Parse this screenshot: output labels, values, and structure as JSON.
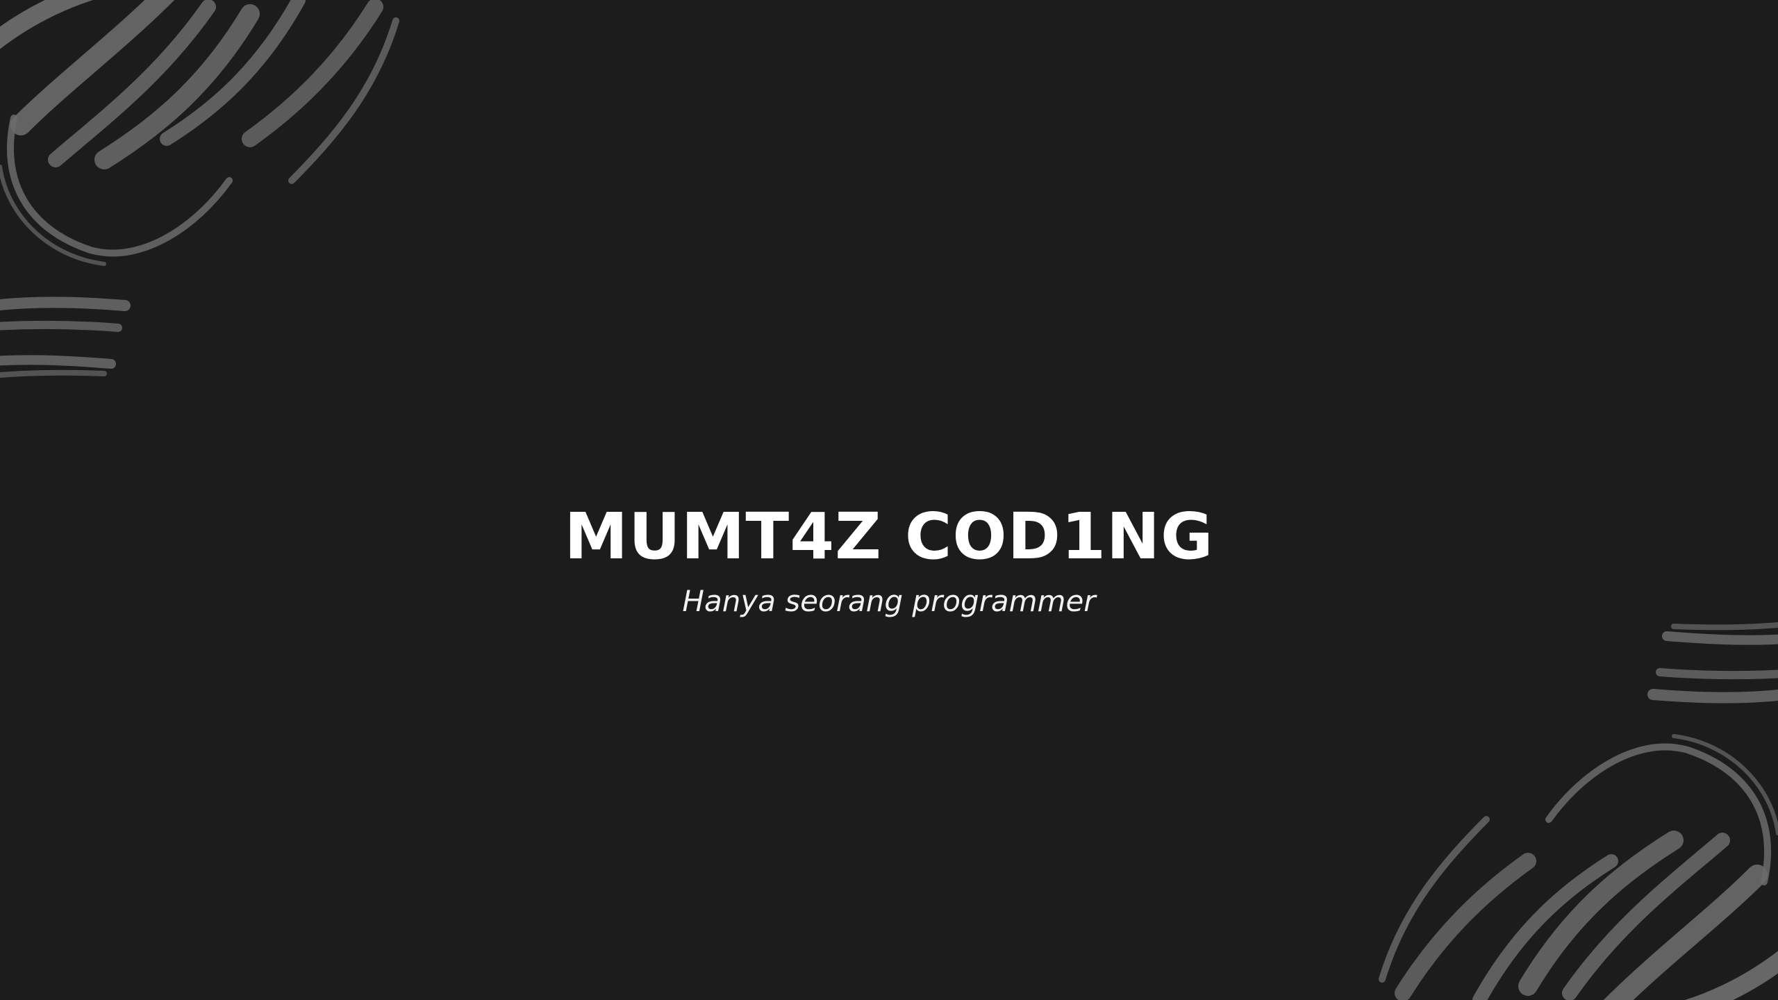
{
  "hero": {
    "title": "MUMT4Z COD1NG",
    "subtitle": "Hanya seorang programmer"
  },
  "decorations": {
    "brush_icon": "brush-stroke-swirl",
    "background_color": "#1c1c1c",
    "brush_color": "#6b6b6b"
  }
}
